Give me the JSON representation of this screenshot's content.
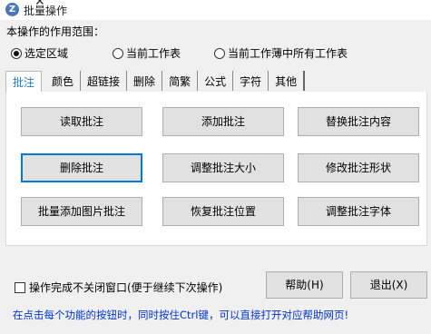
{
  "window": {
    "title": "批量操作"
  },
  "scope": {
    "label": "本操作的作用范围：",
    "options": [
      {
        "label": "选定区域",
        "checked": true
      },
      {
        "label": "当前工作表",
        "checked": false
      },
      {
        "label": "当前工作薄中所有工作表",
        "checked": false
      }
    ]
  },
  "tabs": [
    "批注",
    "颜色",
    "超链接",
    "删除",
    "简繁",
    "公式",
    "字符",
    "其他"
  ],
  "active_tab": "批注",
  "buttons": [
    "读取批注",
    "添加批注",
    "替换批注内容",
    "删除批注",
    "调整批注大小",
    "修改批注形状",
    "批量添加图片批注",
    "恢复批注位置",
    "调整批注字体"
  ],
  "footer": {
    "keep_open_label": "操作完成不关闭窗口(便于继续下次操作)",
    "help_label": "帮助(H)",
    "exit_label": "退出(X)",
    "hint": "在点击每个功能的按钮时，同时按住Ctrl键，可以直接打开对应帮助网页!"
  },
  "colors": {
    "accent": "#0078d7",
    "hint_text": "#0033cc",
    "active_tab_text": "#2277c8"
  }
}
